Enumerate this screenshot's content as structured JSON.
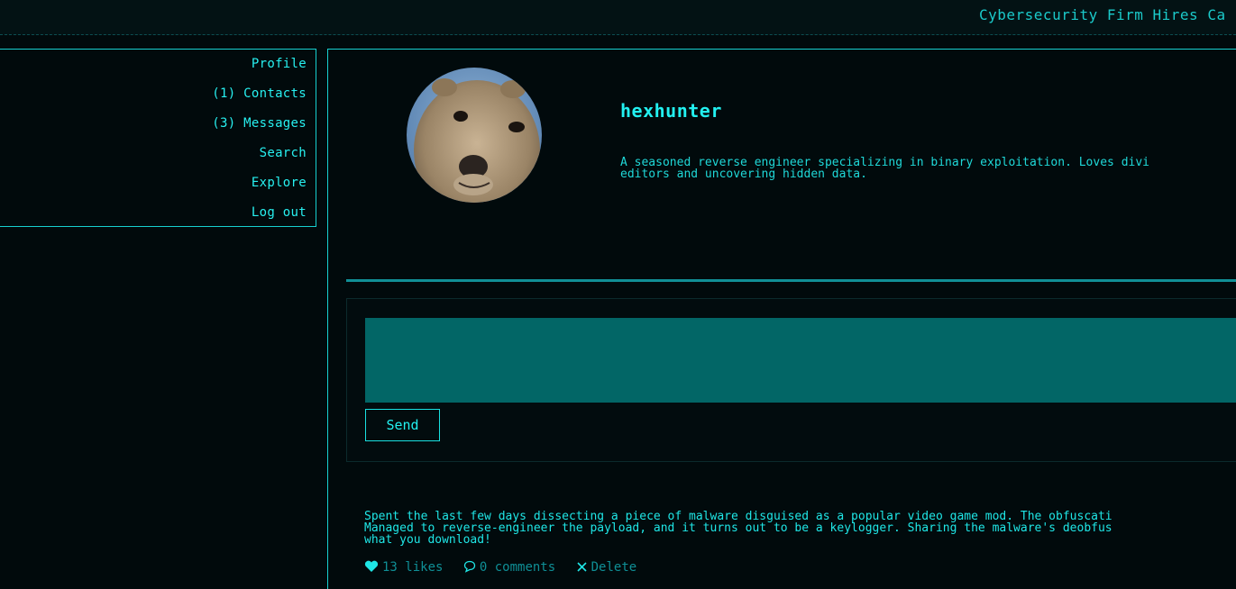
{
  "header": {
    "ticker": "Cybersecurity Firm Hires Ca"
  },
  "nav": {
    "items": [
      {
        "label": "Profile"
      },
      {
        "label": "(1) Contacts"
      },
      {
        "label": "(3) Messages"
      },
      {
        "label": "Search"
      },
      {
        "label": "Explore"
      },
      {
        "label": "Log out"
      }
    ]
  },
  "profile": {
    "username": "hexhunter",
    "bio": "A seasoned reverse engineer specializing in binary exploitation. Loves divi\neditors and uncovering hidden data."
  },
  "composer": {
    "placeholder": "",
    "send_label": "Send"
  },
  "posts": [
    {
      "text": "Spent the last few days dissecting a piece of malware disguised as a popular video game mod. The obfuscati\nManaged to reverse-engineer the payload, and it turns out to be a keylogger. Sharing the malware's deobfus\nwhat you download!",
      "likes": "13 likes",
      "comments": "0 comments",
      "delete_label": "Delete",
      "icons": [
        "heart-icon",
        "comment-icon",
        "close-icon"
      ]
    }
  ],
  "colors": {
    "accent": "#19e3e3",
    "background": "#010a0c",
    "input_fill": "#026666",
    "muted": "#0f8f96"
  }
}
